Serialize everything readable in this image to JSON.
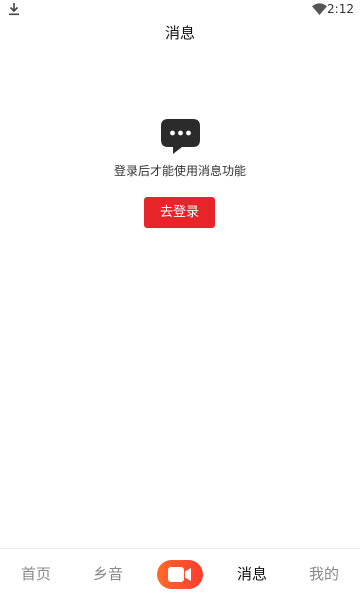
{
  "status_bar": {
    "time": "2:12",
    "icons": [
      "download-icon",
      "wifi-icon"
    ]
  },
  "header": {
    "title": "消息"
  },
  "empty_state": {
    "icon": "chat-bubble-icon",
    "message": "登录后才能使用消息功能",
    "login_button_label": "去登录"
  },
  "bottom_nav": {
    "items": [
      {
        "label": "首页",
        "active": false
      },
      {
        "label": "乡音",
        "active": false
      },
      {
        "label": "",
        "icon": "video-camera-icon",
        "active": false
      },
      {
        "label": "消息",
        "active": true
      },
      {
        "label": "我的",
        "active": false
      }
    ]
  },
  "colors": {
    "accent": "#e8242b",
    "video_button_start": "#ff6a2c",
    "video_button_end": "#ff3b2e",
    "nav_inactive": "#888888",
    "nav_active": "#111111",
    "chat_icon": "#2b2b2b"
  }
}
